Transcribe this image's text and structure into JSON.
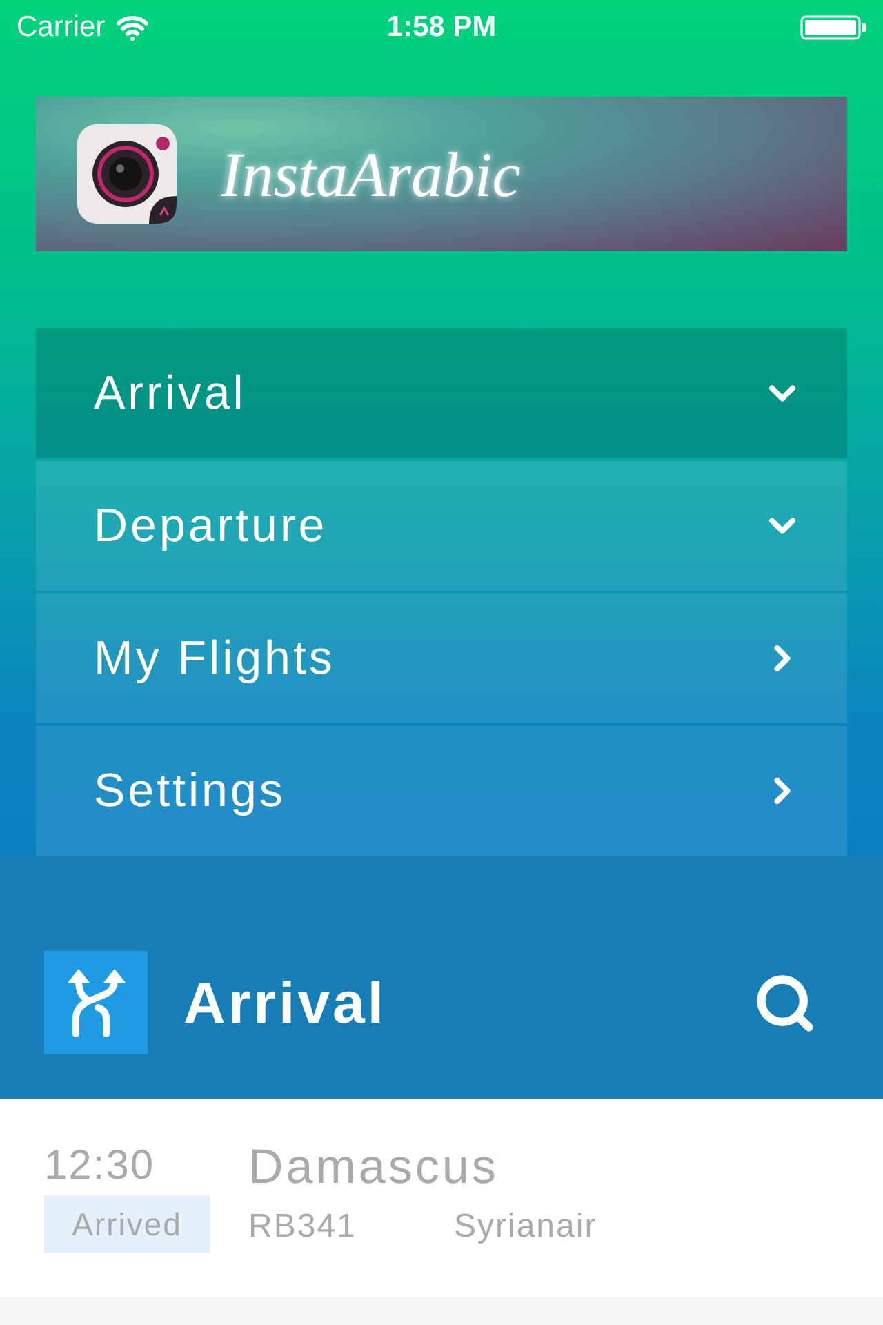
{
  "status_bar": {
    "carrier": "Carrier",
    "time": "1:58 PM"
  },
  "banner": {
    "title": "InstaArabic"
  },
  "menu": {
    "items": [
      {
        "label": "Arrival",
        "kind": "expand",
        "selected": true
      },
      {
        "label": "Departure",
        "kind": "expand",
        "selected": false
      },
      {
        "label": "My Flights",
        "kind": "link",
        "selected": false
      },
      {
        "label": "Settings",
        "kind": "link",
        "selected": false
      }
    ]
  },
  "header": {
    "title": "Arrival"
  },
  "flights": [
    {
      "time": "12:30",
      "status": "Arrived",
      "city": "Damascus",
      "flight_number": "RB341",
      "airline": "Syrianair"
    }
  ]
}
